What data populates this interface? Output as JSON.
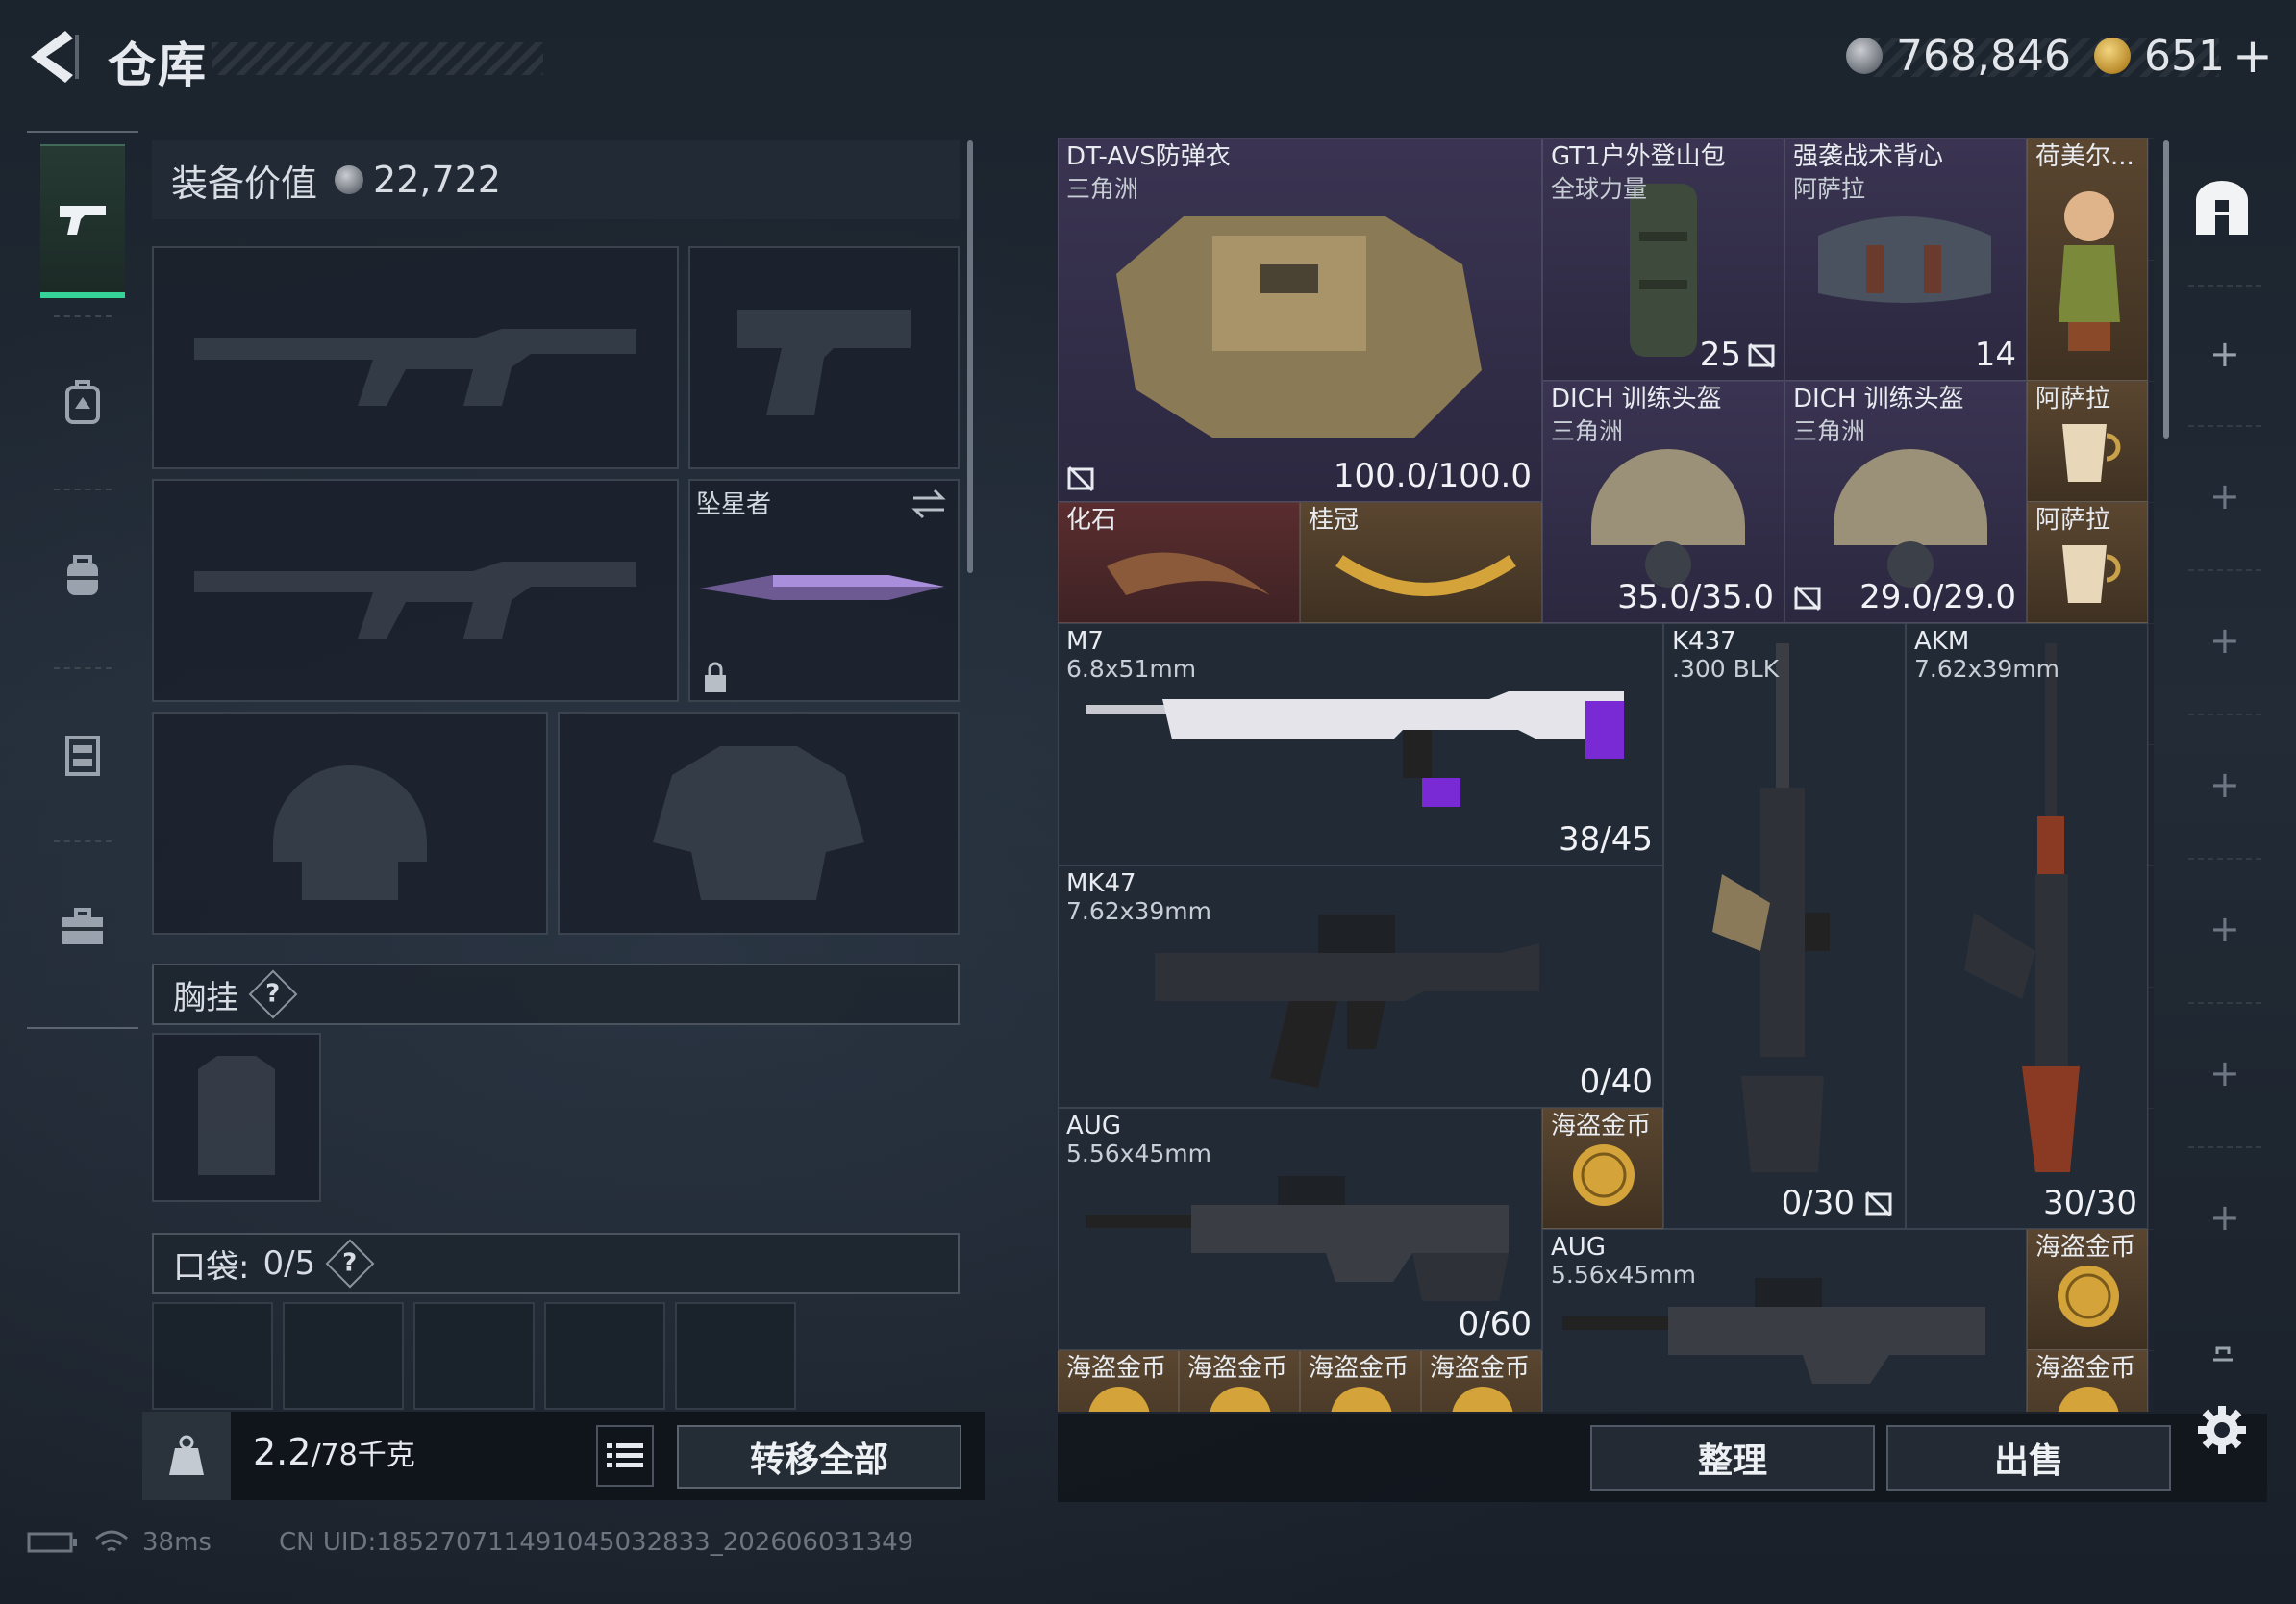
{
  "header": {
    "title": "仓库",
    "silver_amount": "768,846",
    "gold_amount": "651",
    "add_symbol": "+"
  },
  "left": {
    "equip_value_label": "装备价值",
    "equip_value": "22,722",
    "melee_label": "坠星者",
    "chest_rig_label": "胸挂",
    "pocket_label": "口袋:",
    "pocket_count": "0/5",
    "help_symbol": "?",
    "weight_value": "2.2",
    "weight_capacity": "/78千克",
    "transfer_all": "转移全部"
  },
  "items": [
    {
      "name": "DT-AVS防弹衣",
      "sub": "三角洲",
      "count": "100.0/100.0"
    },
    {
      "name": "GT1户外登山包",
      "sub": "全球力量",
      "count": "25"
    },
    {
      "name": "强袭战术背心",
      "sub": "阿萨拉",
      "count": "14"
    },
    {
      "name": "荷美尔...",
      "sub": "",
      "count": ""
    },
    {
      "name": "DICH 训练头盔",
      "sub": "三角洲",
      "count": "35.0/35.0"
    },
    {
      "name": "DICH 训练头盔",
      "sub": "三角洲",
      "count": "29.0/29.0"
    },
    {
      "name": "阿萨拉",
      "sub": "",
      "count": ""
    },
    {
      "name": "阿萨拉",
      "sub": "",
      "count": ""
    },
    {
      "name": "化石",
      "sub": "",
      "count": ""
    },
    {
      "name": "桂冠",
      "sub": "",
      "count": ""
    },
    {
      "name": "M7",
      "sub": "6.8x51mm",
      "count": "38/45"
    },
    {
      "name": "K437",
      "sub": ".300 BLK",
      "count": "0/30"
    },
    {
      "name": "AKM",
      "sub": "7.62x39mm",
      "count": "30/30"
    },
    {
      "name": "MK47",
      "sub": "7.62x39mm",
      "count": "0/40"
    },
    {
      "name": "AUG",
      "sub": "5.56x45mm",
      "count": "0/60"
    },
    {
      "name": "海盗金币",
      "sub": "",
      "count": ""
    },
    {
      "name": "AUG",
      "sub": "5.56x45mm",
      "count": ""
    },
    {
      "name": "海盗金币",
      "sub": "",
      "count": ""
    },
    {
      "name": "海盗金币",
      "sub": "",
      "count": ""
    },
    {
      "name": "海盗金币",
      "sub": "",
      "count": ""
    },
    {
      "name": "海盗金币",
      "sub": "",
      "count": ""
    },
    {
      "name": "海盗金币",
      "sub": "",
      "count": ""
    },
    {
      "name": "海盗金币",
      "sub": "",
      "count": ""
    }
  ],
  "actions": {
    "sort": "整理",
    "sell": "出售"
  },
  "status": {
    "ping": "38ms",
    "uid": "CN UID:18527071149104503283​3_202606031349"
  },
  "colors": {
    "accent_green": "#36d399",
    "purple_rarity": "#3a3452",
    "gold_rarity": "#5a4630",
    "red_rarity": "#5a2d2f"
  },
  "icons": [
    "back-arrow-icon",
    "silver-coin-icon",
    "gold-coin-icon",
    "pistol-icon",
    "backpack-icon",
    "bag-icon",
    "vest-icon",
    "toolbox-icon",
    "lock-icon",
    "swap-icon",
    "list-icon",
    "settings-icon",
    "safe-box-icon",
    "battery-icon",
    "wifi-icon"
  ]
}
